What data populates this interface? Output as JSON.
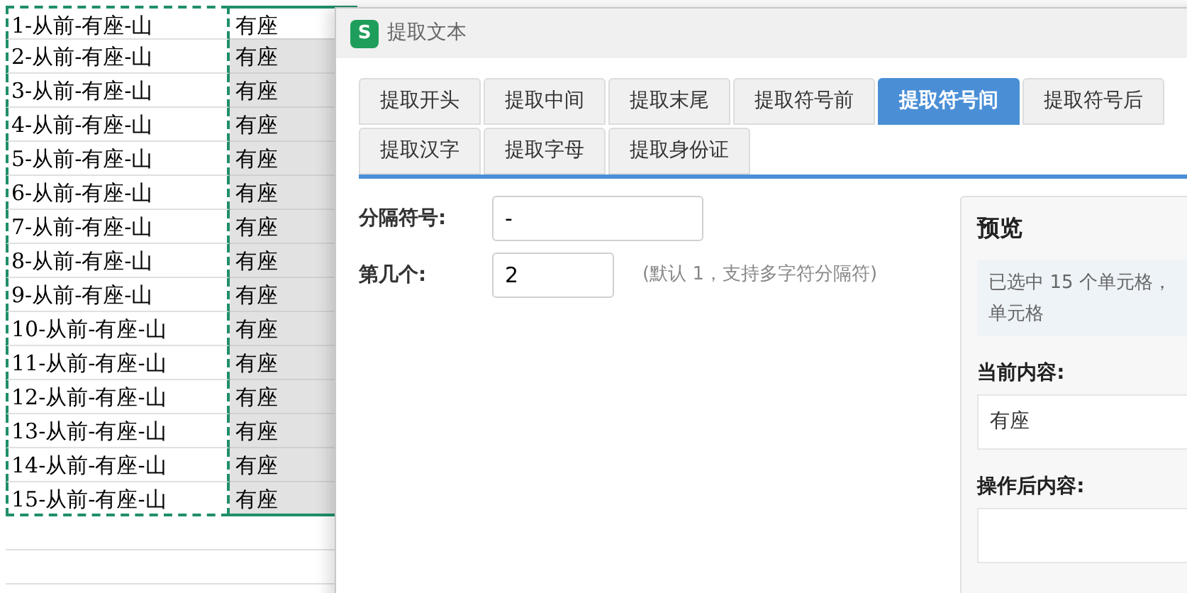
{
  "sheet": {
    "rows": [
      {
        "col_a": "1-从前-有座-山",
        "col_b": "有座"
      },
      {
        "col_a": "2-从前-有座-山",
        "col_b": "有座"
      },
      {
        "col_a": "3-从前-有座-山",
        "col_b": "有座"
      },
      {
        "col_a": "4-从前-有座-山",
        "col_b": "有座"
      },
      {
        "col_a": "5-从前-有座-山",
        "col_b": "有座"
      },
      {
        "col_a": "6-从前-有座-山",
        "col_b": "有座"
      },
      {
        "col_a": "7-从前-有座-山",
        "col_b": "有座"
      },
      {
        "col_a": "8-从前-有座-山",
        "col_b": "有座"
      },
      {
        "col_a": "9-从前-有座-山",
        "col_b": "有座"
      },
      {
        "col_a": "10-从前-有座-山",
        "col_b": "有座"
      },
      {
        "col_a": "11-从前-有座-山",
        "col_b": "有座"
      },
      {
        "col_a": "12-从前-有座-山",
        "col_b": "有座"
      },
      {
        "col_a": "13-从前-有座-山",
        "col_b": "有座"
      },
      {
        "col_a": "14-从前-有座-山",
        "col_b": "有座"
      },
      {
        "col_a": "15-从前-有座-山",
        "col_b": "有座"
      }
    ]
  },
  "dialog": {
    "app_icon": "S",
    "title": "提取文本",
    "tabs": [
      {
        "label": "提取开头",
        "selected": false
      },
      {
        "label": "提取中间",
        "selected": false
      },
      {
        "label": "提取末尾",
        "selected": false
      },
      {
        "label": "提取符号前",
        "selected": false
      },
      {
        "label": "提取符号间",
        "selected": true
      },
      {
        "label": "提取符号后",
        "selected": false
      },
      {
        "label": "提取汉字",
        "selected": false
      },
      {
        "label": "提取字母",
        "selected": false
      },
      {
        "label": "提取身份证",
        "selected": false
      }
    ],
    "separator": {
      "label": "分隔符号:",
      "value": "-"
    },
    "index": {
      "label": "第几个:",
      "value": "2",
      "hint": "(默认 1，支持多字符分隔符)"
    },
    "preview": {
      "title": "预览",
      "info_lines": [
        "已选中 15 个单元格，",
        "单元格"
      ],
      "current_label": "当前内容:",
      "current_value": "有座",
      "result_label": "操作后内容:"
    }
  }
}
